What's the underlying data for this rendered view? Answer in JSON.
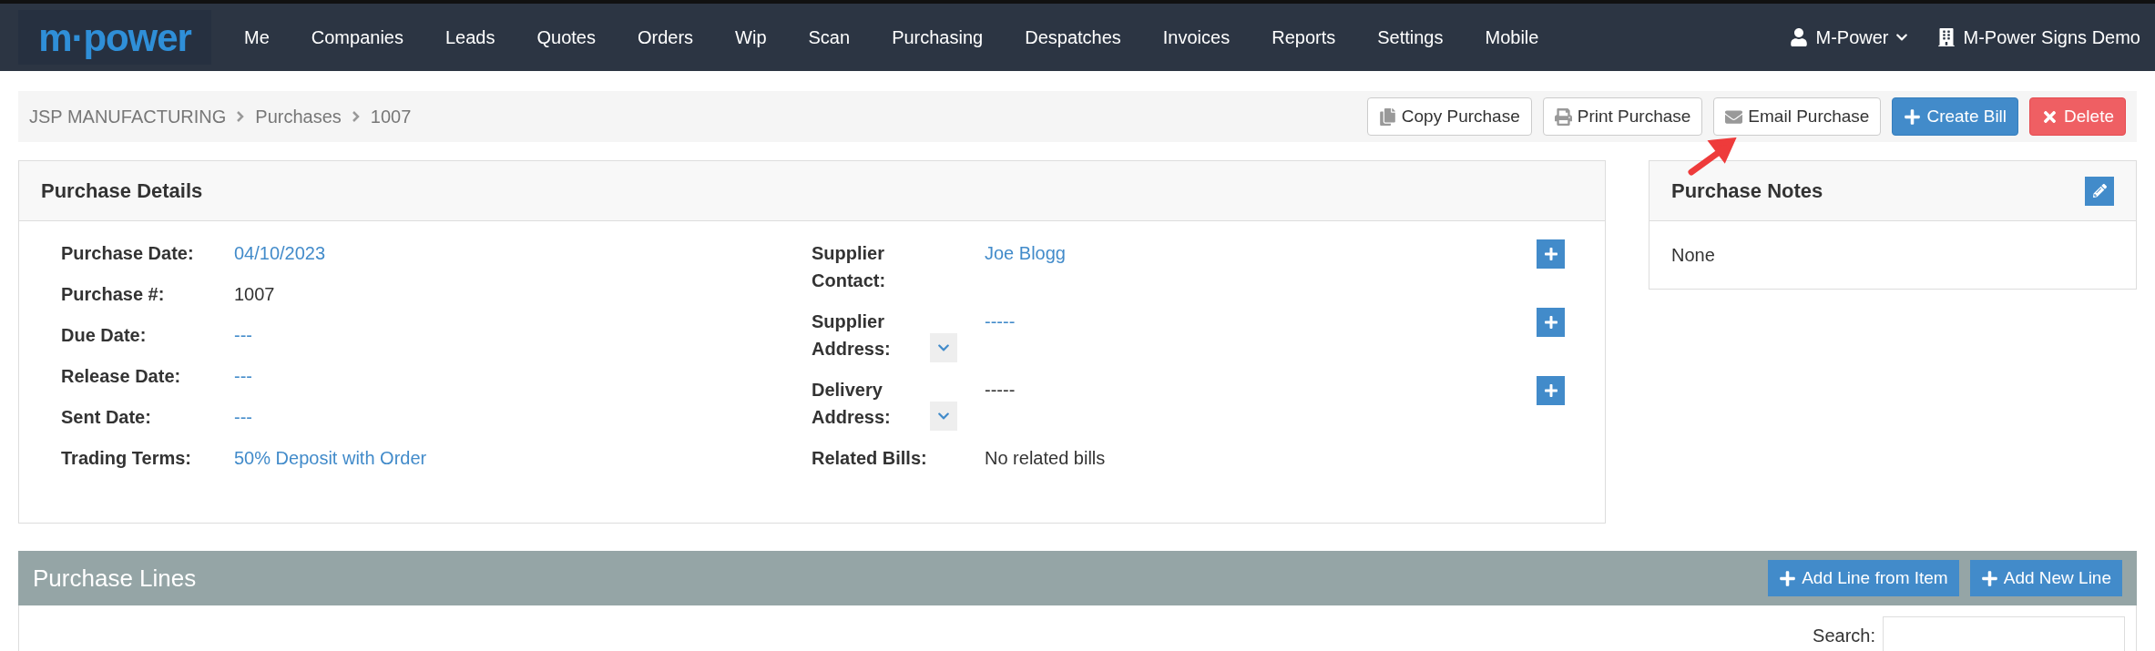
{
  "navbar": {
    "logo": "m·power",
    "items": [
      {
        "label": "Me"
      },
      {
        "label": "Companies"
      },
      {
        "label": "Leads"
      },
      {
        "label": "Quotes"
      },
      {
        "label": "Orders"
      },
      {
        "label": "Wip"
      },
      {
        "label": "Scan"
      },
      {
        "label": "Purchasing"
      },
      {
        "label": "Despatches"
      },
      {
        "label": "Invoices"
      },
      {
        "label": "Reports"
      },
      {
        "label": "Settings"
      },
      {
        "label": "Mobile"
      }
    ],
    "user": "M-Power",
    "company": "M-Power Signs Demo"
  },
  "breadcrumb": [
    "JSP MANUFACTURING",
    "Purchases",
    "1007"
  ],
  "actions": [
    {
      "label": "Copy Purchase",
      "kind": "copy"
    },
    {
      "label": "Print Purchase",
      "kind": "print"
    },
    {
      "label": "Email Purchase",
      "kind": "email",
      "highlighted": true
    },
    {
      "label": "Create Bill",
      "kind": "create"
    },
    {
      "label": "Delete",
      "kind": "delete"
    }
  ],
  "purchase_details": {
    "title": "Purchase Details",
    "left_fields": [
      {
        "label": "Purchase Date:",
        "value": "04/10/2023",
        "kind": "link"
      },
      {
        "label": "Purchase #:",
        "value": "1007",
        "kind": "plain"
      },
      {
        "label": "Due Date:",
        "value": "---",
        "kind": "link"
      },
      {
        "label": "Release Date:",
        "value": "---",
        "kind": "link"
      },
      {
        "label": "Sent Date:",
        "value": "---",
        "kind": "link"
      },
      {
        "label": "Trading Terms:",
        "value": "50% Deposit with Order",
        "kind": "link"
      }
    ],
    "right_fields": [
      {
        "label": "Supplier Contact:",
        "value": "Joe Blogg",
        "kind": "link",
        "dropdown": false,
        "add": true
      },
      {
        "label": "Supplier Address:",
        "value": "-----",
        "kind": "link",
        "dropdown": true,
        "add": true
      },
      {
        "label": "Delivery Address:",
        "value": "-----",
        "kind": "plain",
        "dropdown": true,
        "add": true
      },
      {
        "label": "Related Bills:",
        "value": "No related bills",
        "kind": "plain",
        "dropdown": false,
        "add": false
      }
    ]
  },
  "purchase_notes": {
    "title": "Purchase Notes",
    "body": "None"
  },
  "purchase_lines": {
    "title": "Purchase Lines",
    "buttons": [
      "Add Line from Item",
      "Add New Line"
    ],
    "search_label": "Search:"
  }
}
